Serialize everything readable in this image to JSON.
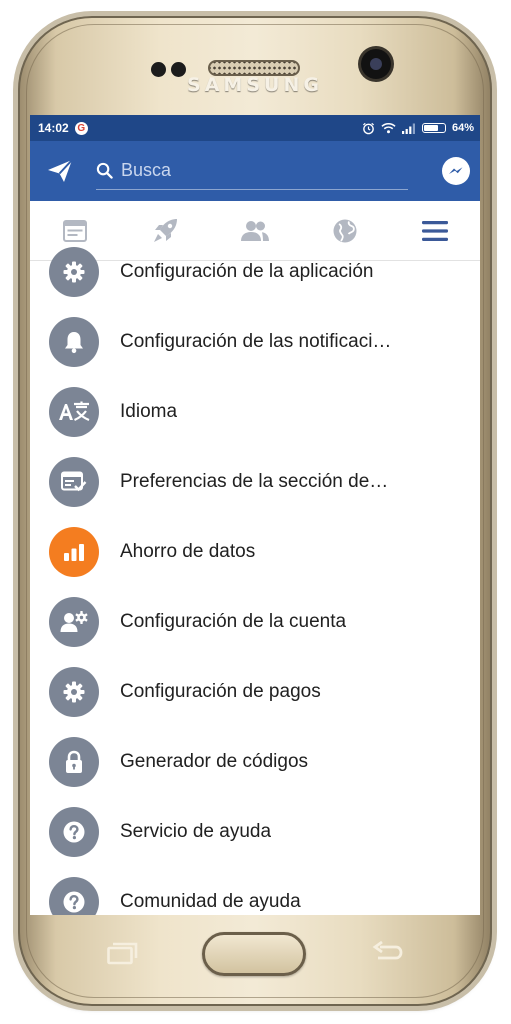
{
  "device": {
    "brand": "SAMSUNG"
  },
  "status_bar": {
    "time": "14:02",
    "battery": "64%"
  },
  "search": {
    "placeholder": "Busca"
  },
  "tabs": [
    {
      "name": "news-feed-icon"
    },
    {
      "name": "rocket-icon"
    },
    {
      "name": "friends-icon"
    },
    {
      "name": "globe-icon"
    },
    {
      "name": "menu-icon"
    }
  ],
  "menu": {
    "items": [
      {
        "label": "Configuración de la aplicación",
        "icon": "gear-icon"
      },
      {
        "label": "Configuración de las notificaci…",
        "icon": "bell-icon"
      },
      {
        "label": "Idioma",
        "icon": "translate-icon"
      },
      {
        "label": "Preferencias de la sección de…",
        "icon": "feed-preferences-icon"
      },
      {
        "label": "Ahorro de datos",
        "icon": "data-saver-icon"
      },
      {
        "label": "Configuración de la cuenta",
        "icon": "account-settings-icon"
      },
      {
        "label": "Configuración de pagos",
        "icon": "gear-icon"
      },
      {
        "label": "Generador de códigos",
        "icon": "lock-icon"
      },
      {
        "label": "Servicio de ayuda",
        "icon": "help-icon"
      },
      {
        "label": "Comunidad de ayuda",
        "icon": "help-icon"
      }
    ]
  },
  "colors": {
    "status_bar": "#1f4788",
    "header": "#2f5ca8",
    "icon_gray": "#7c8595",
    "data_saver": "#f47d20",
    "active_tab": "#3b5998"
  }
}
